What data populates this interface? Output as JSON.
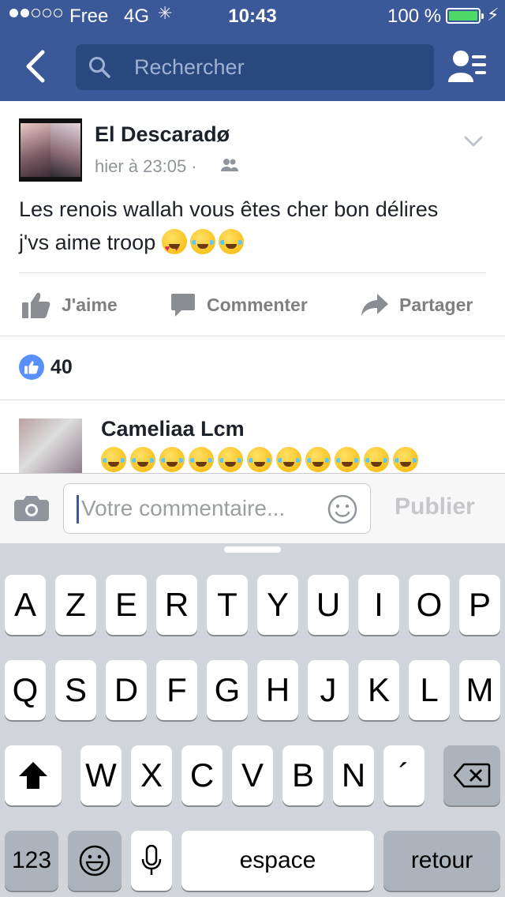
{
  "status_bar": {
    "carrier": "Free",
    "network": "4G",
    "time": "10:43",
    "battery_percent": "100 %",
    "signal_bars": 2
  },
  "nav": {
    "search_placeholder": "Rechercher",
    "back_icon": "chevron-left-icon",
    "friends_icon": "friends-list-icon"
  },
  "post": {
    "author": "El Descaradø",
    "time": "hier à 23:05 ·",
    "text_line1": "Les renois wallah vous êtes cher bon délires",
    "text_line2": "j'vs aime troop",
    "text_emojis": [
      "heart-eyes-emoji",
      "laughing-tears-emoji",
      "laughing-tears-emoji"
    ],
    "actions": {
      "like": "J'aime",
      "comment": "Commenter",
      "share": "Partager"
    },
    "like_count": "40"
  },
  "comment": {
    "author": "Cameliaa Lcm",
    "emoji_count": 11,
    "emoji": "laughing-tears-emoji"
  },
  "composer": {
    "placeholder": "Votre commentaire...",
    "publish": "Publier"
  },
  "keyboard": {
    "row1": [
      "A",
      "Z",
      "E",
      "R",
      "T",
      "Y",
      "U",
      "I",
      "O",
      "P"
    ],
    "row2": [
      "Q",
      "S",
      "D",
      "F",
      "G",
      "H",
      "J",
      "K",
      "L",
      "M"
    ],
    "row3": [
      "W",
      "X",
      "C",
      "V",
      "B",
      "N",
      "´"
    ],
    "numbers": "123",
    "space": "espace",
    "return": "retour"
  },
  "colors": {
    "facebook_blue": "#3b5998",
    "search_bg": "#29487d",
    "battery_green": "#4cd964",
    "keyboard_bg": "#d1d5db"
  }
}
